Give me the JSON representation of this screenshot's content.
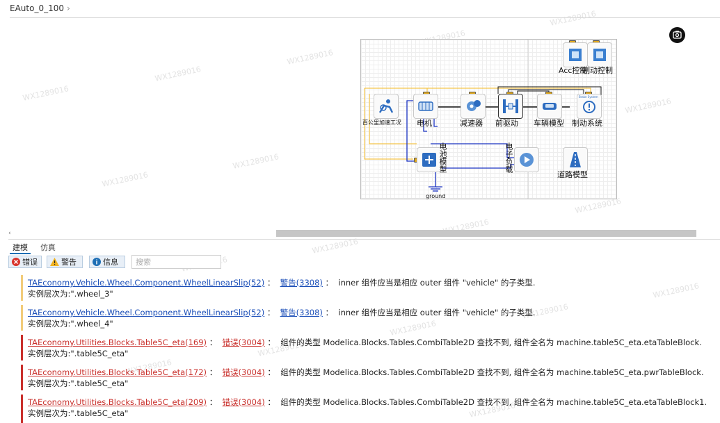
{
  "breadcrumb": {
    "model": "EAuto_0_100"
  },
  "diagram": {
    "labels": {
      "acc": "Acc控制",
      "brake_ctrl": "制动控制",
      "drive_cycle": "百公里加速工况",
      "motor": "电机",
      "reducer": "减速器",
      "front_drive": "前驱动",
      "vehicle": "车辆模型",
      "brake_sys": "制动系统",
      "battery": "电池模型",
      "eload": "电子负载",
      "road": "道路模型",
      "ground": "ground",
      "brake_system_icon_text": "Brake System"
    }
  },
  "tabs": {
    "model": "建模",
    "simulation": "仿真"
  },
  "filters": {
    "error": "错误",
    "warning": "警告",
    "info": "信息"
  },
  "search": {
    "placeholder": "搜索"
  },
  "messages": [
    {
      "type": "warning",
      "source": "TAEconomy.Vehicle.Wheel.Component.WheelLinearSlip(52)",
      "code": "警告(3308)",
      "text": "inner 组件应当是相应 outer 组件 \"vehicle\" 的子类型.",
      "instance": "实例层次为:\".wheel_3\""
    },
    {
      "type": "warning",
      "source": "TAEconomy.Vehicle.Wheel.Component.WheelLinearSlip(52)",
      "code": "警告(3308)",
      "text": "inner 组件应当是相应 outer 组件 \"vehicle\" 的子类型.",
      "instance": "实例层次为:\".wheel_4\""
    },
    {
      "type": "error",
      "source": "TAEconomy.Utilities.Blocks.Table5C_eta(169)",
      "code": "错误(3004)",
      "text": "组件的类型 Modelica.Blocks.Tables.CombiTable2D 查找不到, 组件全名为 machine.table5C_eta.etaTableBlock.",
      "instance": "实例层次为:\".table5C_eta\""
    },
    {
      "type": "error",
      "source": "TAEconomy.Utilities.Blocks.Table5C_eta(172)",
      "code": "错误(3004)",
      "text": "组件的类型 Modelica.Blocks.Tables.CombiTable2D 查找不到, 组件全名为 machine.table5C_eta.pwrTableBlock.",
      "instance": "实例层次为:\".table5C_eta\""
    },
    {
      "type": "error",
      "source": "TAEconomy.Utilities.Blocks.Table5C_eta(209)",
      "code": "错误(3004)",
      "text": "组件的类型 Modelica.Blocks.Tables.CombiTable2D 查找不到, 组件全名为 machine.table5C_eta.etaTableBlock1.",
      "instance": "实例层次为:\".table5C_eta\""
    }
  ],
  "watermark": "WX1289016",
  "colors": {
    "warning_bar": "#f2cc7a",
    "error_bar": "#c9302c",
    "link_blue": "#1c4fb8",
    "accent": "#1f6fb5"
  }
}
